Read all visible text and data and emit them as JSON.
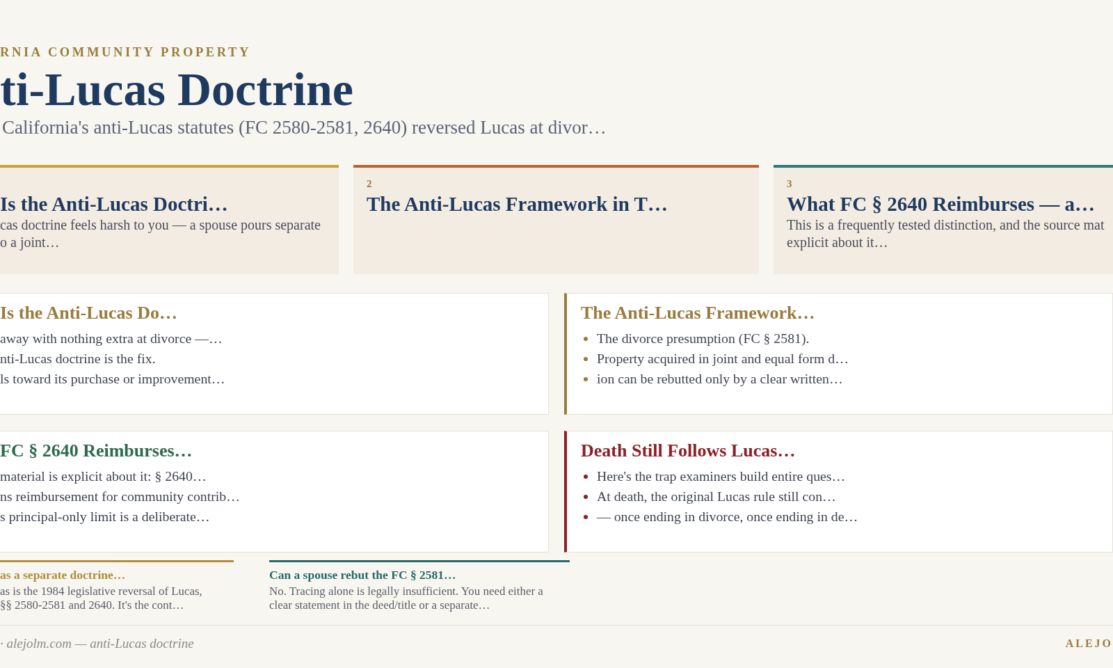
{
  "header": {
    "eyebrow": "RNIA COMMUNITY PROPERTY",
    "title": "ti-Lucas Doctrine",
    "subtitle": "California's anti-Lucas statutes (FC 2580-2581, 2640) reversed Lucas at divor…"
  },
  "topic_cards": [
    {
      "title": "Is the Anti-Lucas Doctri…",
      "color": "#c9a23c",
      "lines": [
        "cas doctrine feels harsh to you — a spouse pours separate",
        "o a joint…"
      ]
    },
    {
      "number": "2",
      "title": "The Anti-Lucas Framework in T…",
      "color": "#b9632f"
    },
    {
      "number": "3",
      "title": "What FC § 2640 Reimburses — a…",
      "color": "#2f7b7a",
      "lines": [
        "This is a frequently tested distinction, and the source mat",
        "explicit about it…"
      ]
    }
  ],
  "section_cards": [
    {
      "kind": "plain",
      "title": "Is the Anti-Lucas Do…",
      "color": "#9a7b3c",
      "items": [
        "away with nothing extra at divorce —…",
        "nti-Lucas doctrine is the fix.",
        "ls toward its purchase or improvement…"
      ]
    },
    {
      "kind": "accent",
      "title": "The Anti-Lucas Framework…",
      "color": "#9a7b3c",
      "items": [
        "The divorce presumption (FC § 2581).",
        "Property acquired in joint and equal form d…",
        "ion can be rebutted only by a clear written…"
      ]
    },
    {
      "kind": "plain",
      "title": "FC § 2640 Reimburses…",
      "color": "#2e6a4e",
      "items": [
        "material is explicit about it: § 2640…",
        "ns reimbursement for community contrib…",
        "s principal-only limit is a deliberate…"
      ]
    },
    {
      "kind": "accent",
      "title": "Death Still Follows Lucas…",
      "color": "#8c1f27",
      "items": [
        "Here's the trap examiners build entire ques…",
        "At death, the original Lucas rule still con…",
        "— once ending in divorce, once ending in de…"
      ]
    }
  ],
  "faq": [
    {
      "question": "as a separate doctrine…",
      "color": "#b08d3a",
      "answer_lines": [
        "as is the 1984 legislative reversal of Lucas,",
        "§§ 2580-2581 and 2640. It's the cont…"
      ]
    },
    {
      "question": "Can a spouse rebut the FC § 2581…",
      "color": "#27696a",
      "answer_lines": [
        "No. Tracing alone is legally insufficient. You need either a",
        "clear statement in the deed/title or a separate…"
      ]
    }
  ],
  "footer": {
    "credit": "· alejolm.com — anti-Lucas doctrine",
    "brand": "ALEJO"
  }
}
